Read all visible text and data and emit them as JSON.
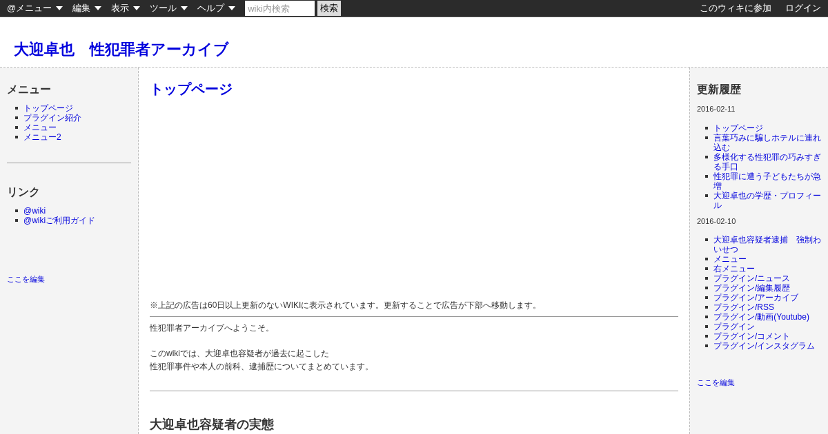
{
  "topbar": {
    "menus": [
      "@メニュー",
      "編集",
      "表示",
      "ツール",
      "ヘルプ"
    ],
    "search": {
      "placeholder": "wiki内検索",
      "button": "検索"
    },
    "right_links": [
      "このウィキに参加",
      "ログイン"
    ]
  },
  "site_title": "大迎卓也　性犯罪者アーカイブ",
  "left_sidebar": {
    "sections": [
      {
        "title": "メニュー",
        "items": [
          "トップページ",
          "プラグイン紹介",
          "メニュー",
          "メニュー2"
        ]
      },
      {
        "title": "リンク",
        "items": [
          "@wiki",
          "@wikiご利用ガイド"
        ]
      }
    ],
    "edit_link": "ここを編集"
  },
  "main": {
    "page_title": "トップページ",
    "ad_notice": "※上記の広告は60日以上更新のないWIKIに表示されています。更新することで広告が下部へ移動します。",
    "welcome": "性犯罪者アーカイブへようこそ。",
    "intro_lines": [
      "このwikiでは、大迎卓也容疑者が過去に起こした",
      "性犯罪事件や本人の前科、逮捕歴についてまとめています。"
    ],
    "section_heading": "大迎卓也容疑者の実態"
  },
  "right_sidebar": {
    "title": "更新履歴",
    "groups": [
      {
        "date": "2016-02-11",
        "items": [
          "トップページ",
          "言葉巧みに騙しホテルに連れ込む",
          "多様化する性犯罪の巧みすぎる手口",
          "性犯罪に遭う子どもたちが急増",
          "大迎卓也の学歴・プロフィール"
        ]
      },
      {
        "date": "2016-02-10",
        "items": [
          "大迎卓也容疑者逮捕　強制わいせつ",
          "メニュー",
          "右メニュー",
          "プラグイン/ニュース",
          "プラグイン/編集履歴",
          "プラグイン/アーカイブ",
          "プラグイン/RSS",
          "プラグイン/動画(Youtube)",
          "プラグイン",
          "プラグイン/コメント",
          "プラグイン/インスタグラム"
        ]
      }
    ],
    "edit_link": "ここを編集"
  }
}
